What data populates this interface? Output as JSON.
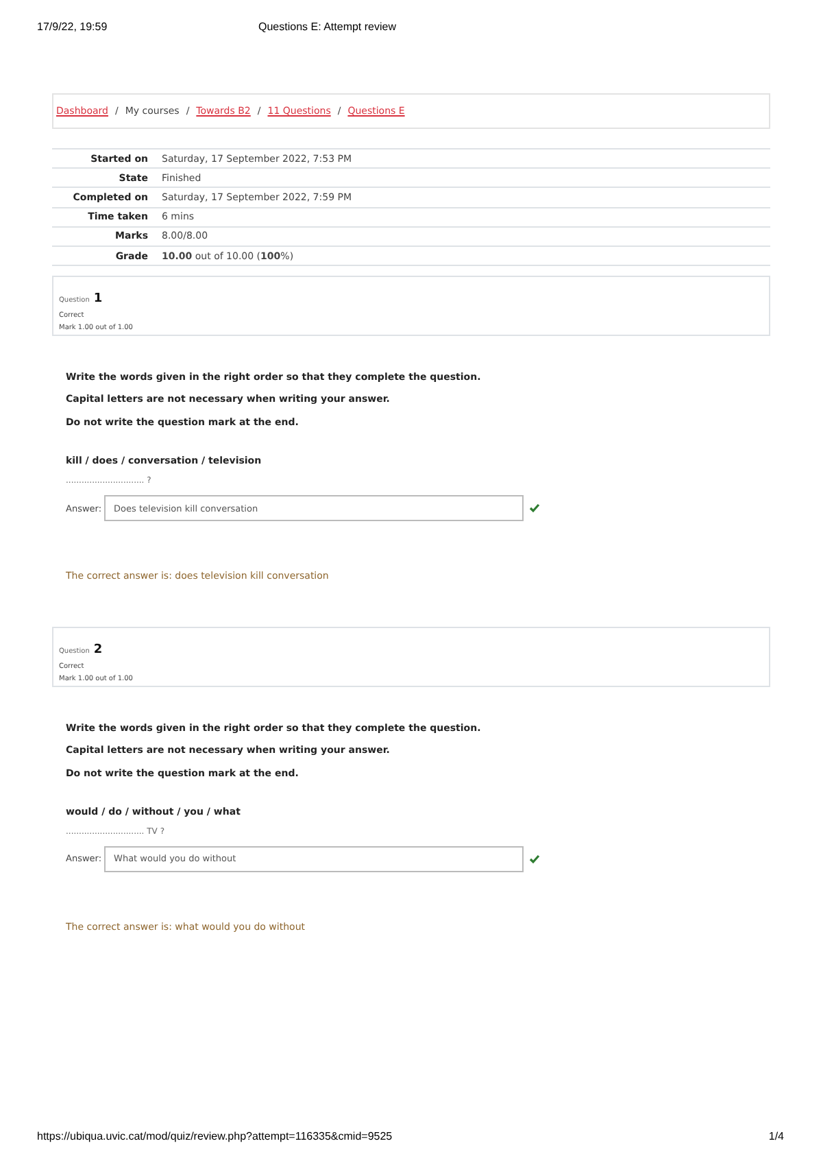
{
  "print_header": {
    "date": "17/9/22, 19:59",
    "title": "Questions E: Attempt review"
  },
  "breadcrumb": [
    {
      "label": "Dashboard",
      "link": true
    },
    {
      "label": "My courses",
      "link": false
    },
    {
      "label": "Towards B2",
      "link": true
    },
    {
      "label": "11 Questions",
      "link": true
    },
    {
      "label": "Questions E",
      "link": true
    }
  ],
  "breadcrumb_separator": "/",
  "summary": [
    {
      "label": "Started on",
      "value": "Saturday, 17 September 2022, 7:53 PM"
    },
    {
      "label": "State",
      "value": "Finished"
    },
    {
      "label": "Completed on",
      "value": "Saturday, 17 September 2022, 7:59 PM"
    },
    {
      "label": "Time taken",
      "value": "6 mins"
    },
    {
      "label": "Marks",
      "value": "8.00/8.00"
    },
    {
      "label": "Grade",
      "value": "**10.00** out of 10.00 (**100**%)"
    }
  ],
  "questions": [
    {
      "label": "Question",
      "number": "1",
      "state": "Correct",
      "mark": "Mark 1.00 out of 1.00",
      "instructions": [
        "Write the words given in the right order so that they complete the question.",
        "Capital letters are not necessary when writing your answer.",
        "Do not write the question mark at the end."
      ],
      "words": "kill / does / conversation / television",
      "blank": "..............................",
      "blank_suffix": "?",
      "answer_label": "Answer:",
      "answer": "Does television kill conversation",
      "correct": true,
      "correct_answer": "The correct answer is: does television kill conversation"
    },
    {
      "label": "Question",
      "number": "2",
      "state": "Correct",
      "mark": "Mark 1.00 out of 1.00",
      "instructions": [
        "Write the words given in the right order so that they complete the question.",
        "Capital letters are not necessary when writing your answer.",
        "Do not write the question mark at the end."
      ],
      "words": "would / do / without / you / what",
      "blank": "..............................",
      "blank_suffix": "TV ?",
      "answer_label": "Answer:",
      "answer": "What would you do without",
      "correct": true,
      "correct_answer": "The correct answer is: what would you do without"
    }
  ],
  "print_footer": {
    "url": "https://ubiqua.uvic.cat/mod/quiz/review.php?attempt=116335&cmid=9525",
    "page": "1/4"
  }
}
